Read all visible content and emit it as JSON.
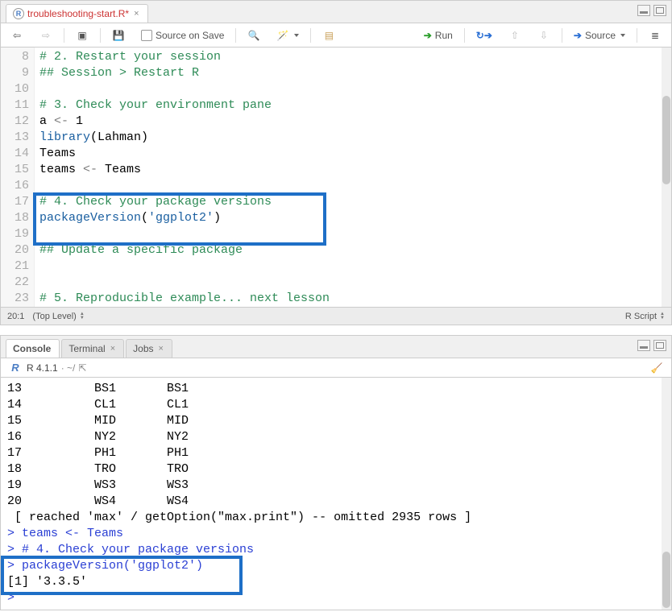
{
  "editor": {
    "tab_title": "troubleshooting-start.R*",
    "toolbar": {
      "source_on_save": "Source on Save",
      "run": "Run",
      "source": "Source"
    },
    "lines": [
      {
        "n": 8,
        "tokens": [
          {
            "c": "c-comment",
            "t": "# 2. Restart your session"
          }
        ]
      },
      {
        "n": 9,
        "tokens": [
          {
            "c": "c-comment",
            "t": "## Session > Restart R"
          }
        ]
      },
      {
        "n": 10,
        "tokens": []
      },
      {
        "n": 11,
        "tokens": [
          {
            "c": "c-comment",
            "t": "# 3. Check your environment pane"
          }
        ]
      },
      {
        "n": 12,
        "tokens": [
          {
            "c": "c-id",
            "t": "a "
          },
          {
            "c": "c-op",
            "t": "<-"
          },
          {
            "c": "c-id",
            "t": " 1"
          }
        ]
      },
      {
        "n": 13,
        "tokens": [
          {
            "c": "c-kw",
            "t": "library"
          },
          {
            "c": "c-id",
            "t": "(Lahman)"
          }
        ]
      },
      {
        "n": 14,
        "tokens": [
          {
            "c": "c-id",
            "t": "Teams"
          }
        ]
      },
      {
        "n": 15,
        "tokens": [
          {
            "c": "c-id",
            "t": "teams "
          },
          {
            "c": "c-op",
            "t": "<-"
          },
          {
            "c": "c-id",
            "t": " Teams"
          }
        ]
      },
      {
        "n": 16,
        "tokens": []
      },
      {
        "n": 17,
        "tokens": [
          {
            "c": "c-comment",
            "t": "# 4. Check your package versions"
          }
        ]
      },
      {
        "n": 18,
        "tokens": [
          {
            "c": "c-kw",
            "t": "packageVersion"
          },
          {
            "c": "c-id",
            "t": "("
          },
          {
            "c": "c-str",
            "t": "'ggplot2'"
          },
          {
            "c": "c-id",
            "t": ")"
          }
        ]
      },
      {
        "n": 19,
        "tokens": []
      },
      {
        "n": 20,
        "tokens": [
          {
            "c": "c-comment",
            "t": "## Update a specific package"
          }
        ]
      },
      {
        "n": 21,
        "tokens": []
      },
      {
        "n": 22,
        "tokens": []
      },
      {
        "n": 23,
        "tokens": [
          {
            "c": "c-comment",
            "t": "# 5. Reproducible example... next lesson"
          }
        ]
      }
    ],
    "status": {
      "pos": "20:1",
      "scope": "(Top Level)",
      "lang": "R Script"
    }
  },
  "tabs": {
    "console": "Console",
    "terminal": "Terminal",
    "jobs": "Jobs"
  },
  "console": {
    "version": "R 4.1.1",
    "path": "· ~/",
    "lines": [
      {
        "cls": "con-gray",
        "t": "13          BS1       BS1"
      },
      {
        "cls": "con-gray",
        "t": "14          CL1       CL1"
      },
      {
        "cls": "con-gray",
        "t": "15          MID       MID"
      },
      {
        "cls": "con-gray",
        "t": "16          NY2       NY2"
      },
      {
        "cls": "con-gray",
        "t": "17          PH1       PH1"
      },
      {
        "cls": "con-gray",
        "t": "18          TRO       TRO"
      },
      {
        "cls": "con-gray",
        "t": "19          WS3       WS3"
      },
      {
        "cls": "con-gray",
        "t": "20          WS4       WS4"
      },
      {
        "cls": "con-gray",
        "t": " [ reached 'max' / getOption(\"max.print\") -- omitted 2935 rows ]"
      },
      {
        "cls": "con-blue",
        "t": "> teams <- Teams"
      },
      {
        "cls": "con-blue",
        "t": "> # 4. Check your package versions"
      },
      {
        "cls": "con-blue",
        "t": "> packageVersion('ggplot2')"
      },
      {
        "cls": "con-gray",
        "t": "[1] '3.3.5'"
      },
      {
        "cls": "con-blue",
        "t": "> "
      }
    ]
  }
}
